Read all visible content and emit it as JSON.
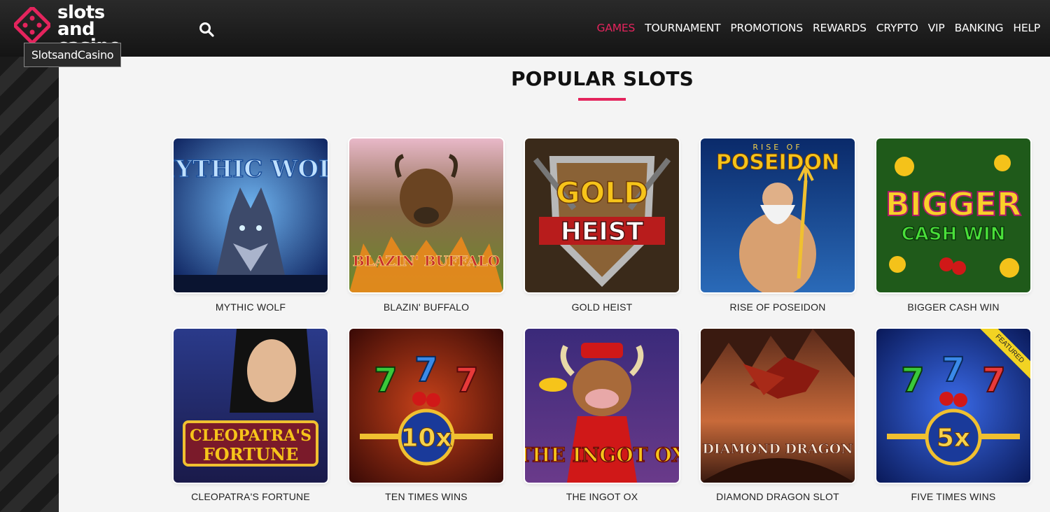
{
  "brand": {
    "logo_line1": "slots",
    "logo_line2": "and",
    "logo_line3": "casino",
    "tooltip": "SlotsandCasino",
    "accent_color": "#e4245d"
  },
  "nav": {
    "items": [
      "GAMES",
      "TOURNAMENT",
      "PROMOTIONS",
      "REWARDS",
      "CRYPTO",
      "VIP",
      "BANKING",
      "HELP"
    ],
    "active": "GAMES"
  },
  "section": {
    "title": "POPULAR SLOTS"
  },
  "games": [
    {
      "name": "MYTHIC WOLF",
      "art_title": "MYTHIC WOLF"
    },
    {
      "name": "BLAZIN' BUFFALO",
      "art_title": "BLAZIN' BUFFALO"
    },
    {
      "name": "GOLD HEIST",
      "art_title_1": "GOLD",
      "art_title_2": "HEIST"
    },
    {
      "name": "RISE OF POSEIDON",
      "art_title_1": "RISE OF",
      "art_title_2": "POSEIDON"
    },
    {
      "name": "BIGGER CASH WIN",
      "art_title_1": "BIGGER",
      "art_title_2": "CASH WIN"
    },
    {
      "name": "CLEOPATRA'S FORTUNE",
      "art_title_1": "CLEOPATRA'S",
      "art_title_2": "FORTUNE"
    },
    {
      "name": "TEN TIMES WINS",
      "art_title": "10x"
    },
    {
      "name": "THE INGOT OX",
      "art_title": "THE INGOT OX"
    },
    {
      "name": "DIAMOND DRAGON SLOT",
      "art_title": "DIAMOND DRAGON"
    },
    {
      "name": "FIVE TIMES WINS",
      "art_title": "5x",
      "badge": "FEATURED"
    }
  ]
}
